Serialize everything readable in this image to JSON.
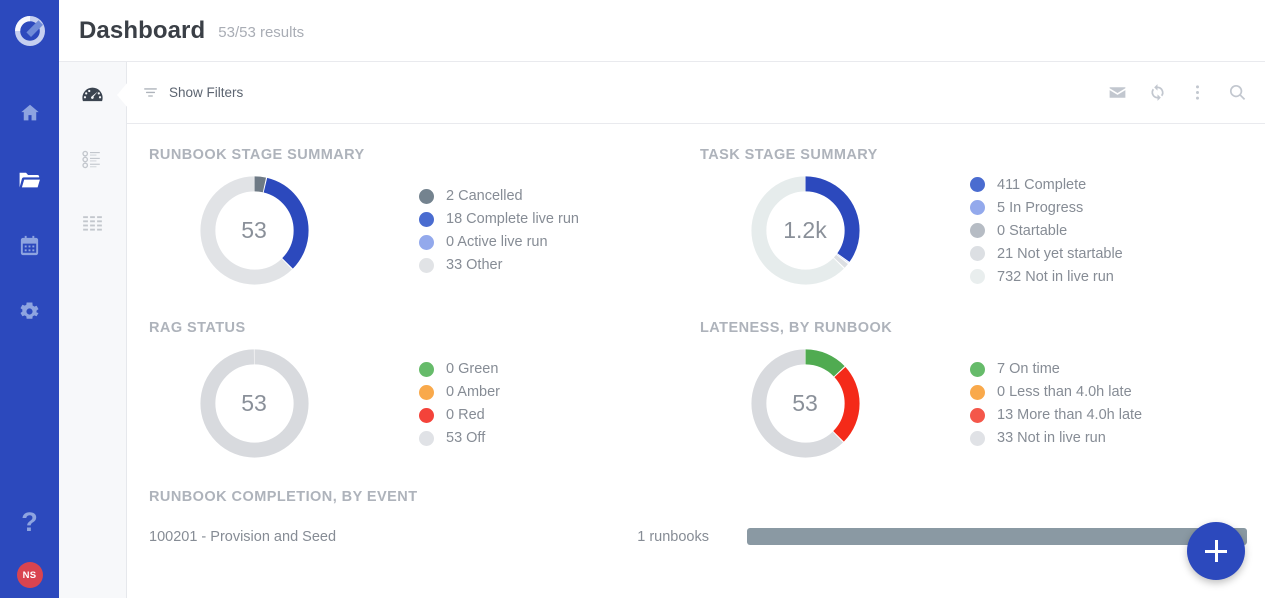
{
  "brand": {
    "primary": "#2c49bd",
    "avatar_initials": "NS",
    "avatar_color": "#d9444f"
  },
  "header": {
    "title": "Dashboard",
    "results": "53/53 results"
  },
  "rail": {
    "logo_icon": "cutover-logo-icon",
    "items": [
      {
        "name": "home",
        "icon": "home-icon",
        "active": false
      },
      {
        "name": "workspaces",
        "icon": "folder-open-icon",
        "active": true
      },
      {
        "name": "calendar",
        "icon": "calendar-icon",
        "active": false
      },
      {
        "name": "settings",
        "icon": "gear-icon",
        "active": false
      }
    ],
    "help_label": "?",
    "help_icon": "question-mark-icon"
  },
  "subrail": {
    "items": [
      {
        "name": "dashboard",
        "icon": "dashboard-gauge-icon",
        "selected": true
      },
      {
        "name": "runbooks-list",
        "icon": "task-list-icon",
        "selected": false
      },
      {
        "name": "schedule-grid",
        "icon": "grid-rows-icon",
        "selected": false
      }
    ]
  },
  "toolbar": {
    "show_filters_label": "Show Filters",
    "filter_icon": "filter-icon",
    "actions": [
      {
        "name": "mail",
        "icon": "envelope-icon"
      },
      {
        "name": "refresh",
        "icon": "sync-refresh-icon"
      },
      {
        "name": "more",
        "icon": "more-vertical-icon"
      },
      {
        "name": "search",
        "icon": "search-icon"
      }
    ]
  },
  "chart_data": [
    {
      "type": "pie",
      "name": "runbook-stage-summary",
      "title": "Runbook Stage Summary",
      "center_label": "53",
      "total": 53,
      "legend_position": "right",
      "categories": [
        "Cancelled",
        "Complete live run",
        "Active live run",
        "Other"
      ],
      "values": [
        2,
        18,
        0,
        33
      ],
      "colors": [
        "#6e7a85",
        "#2c49bd",
        "#93a9ec",
        "#e1e3e6"
      ],
      "legend_colors": [
        "#74838f",
        "#4a6cd0",
        "#93a9ec",
        "#e1e3e6"
      ],
      "legend": [
        "2 Cancelled",
        "18 Complete live run",
        "0 Active live run",
        "33 Other"
      ]
    },
    {
      "type": "pie",
      "name": "task-stage-summary",
      "title": "Task Stage Summary",
      "center_label": "1.2k",
      "total": 1169,
      "legend_position": "right",
      "categories": [
        "Complete",
        "In Progress",
        "Startable",
        "Not yet startable",
        "Not in live run"
      ],
      "values": [
        411,
        5,
        0,
        21,
        732
      ],
      "colors": [
        "#2c49bd",
        "#93a9ec",
        "#b6bcc4",
        "#dcdfe3",
        "#e6ecec"
      ],
      "legend_colors": [
        "#4a6cd0",
        "#93a9ec",
        "#b6bcc4",
        "#dcdfe3",
        "#e9eeee"
      ],
      "legend": [
        "411 Complete",
        "5 In Progress",
        "0 Startable",
        "21 Not yet startable",
        "732 Not in live run"
      ]
    },
    {
      "type": "pie",
      "name": "rag-status",
      "title": "RAG Status",
      "center_label": "53",
      "total": 53,
      "legend_position": "right",
      "categories": [
        "Green",
        "Amber",
        "Red",
        "Off"
      ],
      "values": [
        0,
        0,
        0,
        53
      ],
      "colors": [
        "#5cb85c",
        "#f9a94b",
        "#f4433a",
        "#d8dade"
      ],
      "legend_colors": [
        "#66bb6a",
        "#f9a94b",
        "#f4433a",
        "#e0e2e6"
      ],
      "legend": [
        "0 Green",
        "0 Amber",
        "0 Red",
        "53 Off"
      ]
    },
    {
      "type": "pie",
      "name": "lateness-by-runbook",
      "title": "Lateness, by Runbook",
      "center_label": "53",
      "total": 53,
      "legend_position": "right",
      "categories": [
        "On time",
        "Less than 4.0h late",
        "More than 4.0h late",
        "Not in live run"
      ],
      "values": [
        7,
        0,
        13,
        33
      ],
      "colors": [
        "#50ab51",
        "#f9a94b",
        "#f42a19",
        "#d8dade"
      ],
      "legend_colors": [
        "#66bb6a",
        "#f9a94b",
        "#f4574a",
        "#e0e2e6"
      ],
      "legend": [
        "7 On time",
        "0 Less than 4.0h late",
        "13 More than 4.0h late",
        "33 Not in live run"
      ]
    }
  ],
  "bottom_panel": {
    "title": "Runbook Completion, by Event",
    "rows": [
      {
        "name": "100201 - Provision and Seed",
        "count": "1 runbooks",
        "bar_color": "#8a99a3"
      }
    ]
  },
  "fab": {
    "label": "+",
    "icon": "plus-icon"
  }
}
